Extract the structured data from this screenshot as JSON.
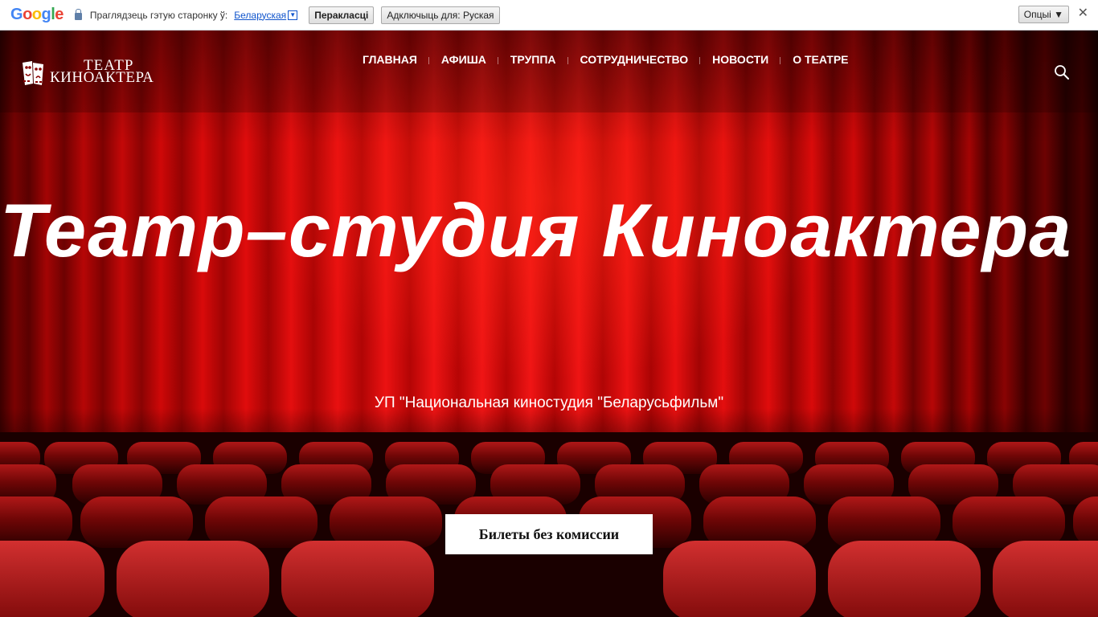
{
  "translate_bar": {
    "logo": "Google",
    "prompt": "Праглядзець гэтую старонку ў:",
    "language": "Беларуская",
    "translate_button": "Перакласці",
    "disable_button": "Адключыць для: Руская",
    "options_button": "Опцыі ▼",
    "close": "✕"
  },
  "header": {
    "logo_line1": "ТЕАТР",
    "logo_line2": "КИНОАКТЕРА",
    "nav": [
      "ГЛАВНАЯ",
      "АФИША",
      "ТРУППА",
      "СОТРУДНИЧЕСТВО",
      "НОВОСТИ",
      "О ТЕАТРЕ"
    ]
  },
  "hero": {
    "title": "Театр–студия Киноактера",
    "subtitle": "УП \"Национальная киностудия \"Беларусьфильм\"",
    "cta": "Билеты без комиссии"
  },
  "icons": {
    "search": "search-icon",
    "lock": "lock-icon",
    "logo": "theatre-masks-icon"
  }
}
